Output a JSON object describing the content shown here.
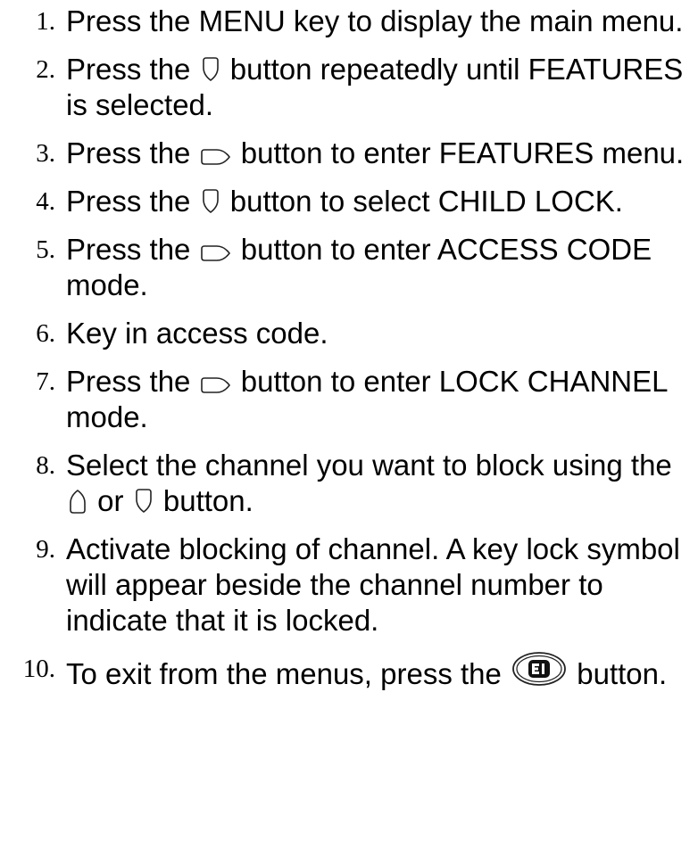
{
  "steps": [
    {
      "number": "1.",
      "parts": [
        "Press the MENU key to display the main menu."
      ],
      "icons": []
    },
    {
      "number": "2.",
      "parts": [
        "Press the",
        "button repeatedly until FEATURES is selected."
      ],
      "icons": [
        "down-arrow-icon"
      ]
    },
    {
      "number": "3.",
      "parts": [
        "Press the",
        "button to enter FEATURES menu."
      ],
      "icons": [
        "right-arrow-icon"
      ]
    },
    {
      "number": "4.",
      "parts": [
        "Press the",
        "button to select CHILD LOCK."
      ],
      "icons": [
        "down-arrow-icon"
      ]
    },
    {
      "number": "5.",
      "parts": [
        "Press the",
        "button to enter ACCESS CODE mode."
      ],
      "icons": [
        "right-arrow-icon"
      ]
    },
    {
      "number": "6.",
      "parts": [
        "Key in access code."
      ],
      "icons": []
    },
    {
      "number": "7.",
      "parts": [
        "Press the",
        "button to enter LOCK CHANNEL mode."
      ],
      "icons": [
        "right-arrow-icon"
      ]
    },
    {
      "number": "8.",
      "parts": [
        "Select the channel you want to block using the",
        "or",
        "button."
      ],
      "icons": [
        "up-arrow-icon",
        "down-arrow-icon"
      ]
    },
    {
      "number": "9.",
      "parts": [
        "Activate blocking of channel. A key lock symbol will appear beside the channel number to indicate that it is locked."
      ],
      "icons": []
    },
    {
      "number": "10.",
      "parts": [
        "To exit from the menus, press the",
        "button."
      ],
      "icons": [
        "exit-button-icon"
      ]
    }
  ]
}
